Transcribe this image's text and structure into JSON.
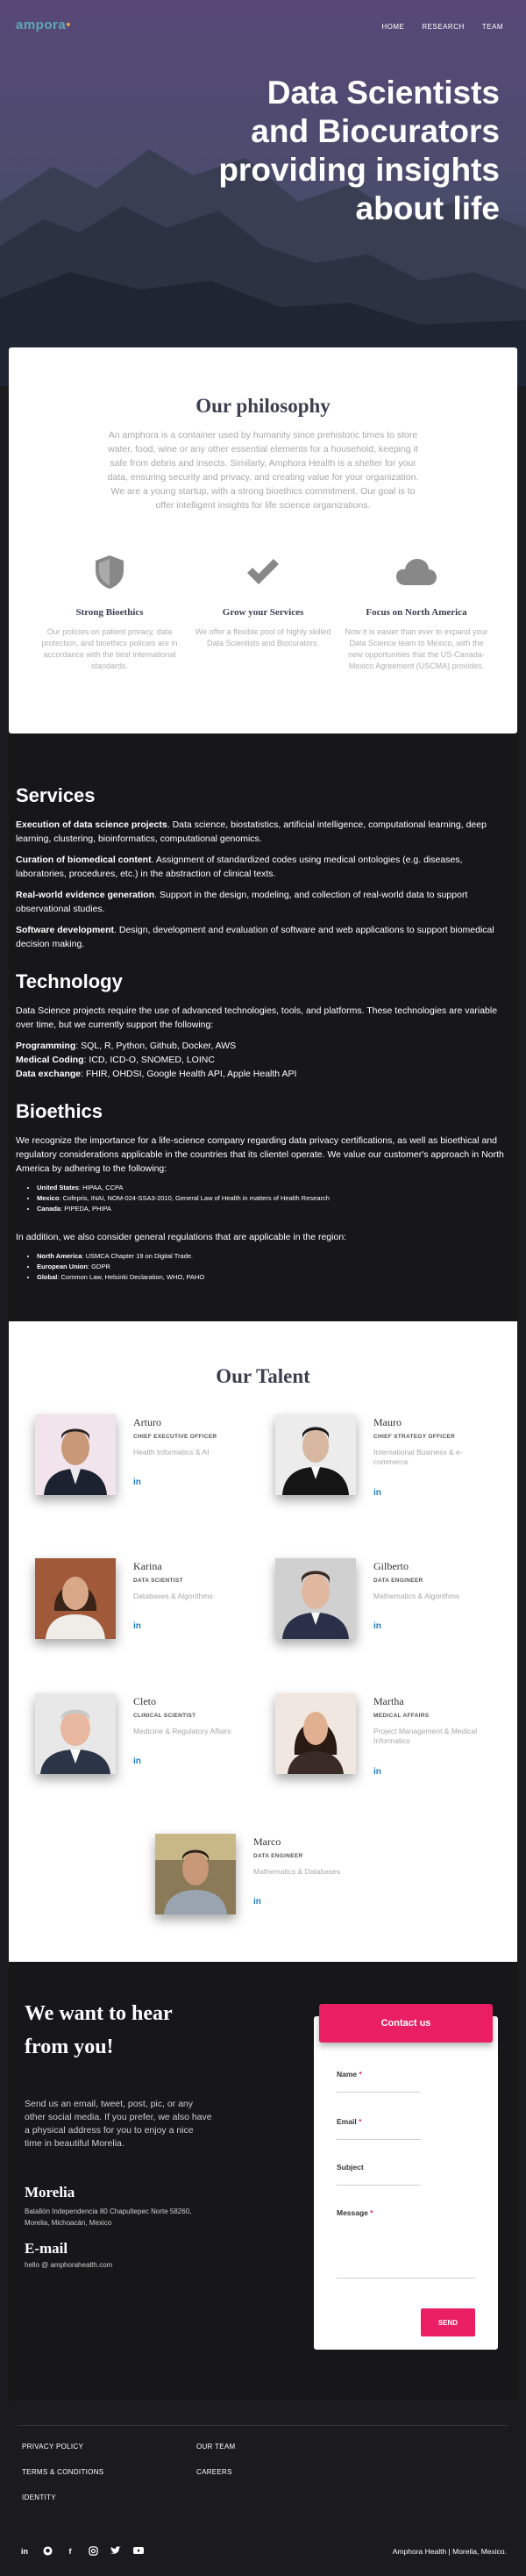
{
  "brand": {
    "logo_text": "ampora"
  },
  "nav": {
    "items": [
      "HOME",
      "RESEARCH",
      "TEAM"
    ]
  },
  "hero": {
    "title": "Data Scientists and Biocurators providing insights about life"
  },
  "philosophy": {
    "title": "Our philosophy",
    "text": "An amphora is a container used by humanity since prehistoric times to store water, food, wine or any other essential elements for a household, keeping it safe from debris and insects. Similarly, Amphora Health is a shelter for your data, ensuring security and privacy, and creating value for your organization. We are a young startup, with a strong bioethics commitment. Our goal is to offer intelligent insights for life science organizations.",
    "features": [
      {
        "icon": "shield-icon",
        "title": "Strong Bioethics",
        "text": "Our policies on patient privacy, data protection, and bioethics policies are in accordance with the best international standards."
      },
      {
        "icon": "check-icon",
        "title": "Grow your Services",
        "text": "We offer a flexible pool of highly skilled Data Scientists and Biocurators."
      },
      {
        "icon": "cloud-icon",
        "title": "Focus on North America",
        "text": "Now it is easier than ever to expand your Data Science team to Mexico, with the new opportunities that the US-Canada-Mexico Agreement (USCMA) provides."
      }
    ]
  },
  "services": {
    "title": "Services",
    "items": [
      {
        "label": "Execution of data science projects",
        "text": ". Data science, biostatistics, artificial intelligence, computational learning, deep learning, clustering, bioinformatics, computational genomics."
      },
      {
        "label": "Curation of biomedical content",
        "text": ". Assignment of standardized codes using medical ontologies (e.g. diseases, laboratories, procedures, etc.) in the abstraction of clinical texts."
      },
      {
        "label": "Real-world evidence generation",
        "text": ". Support in the design, modeling, and collection of real-world data to support observational studies."
      },
      {
        "label": "Software development",
        "text": ". Design, development and evaluation of software and web applications to support biomedical decision making."
      }
    ]
  },
  "technology": {
    "title": "Technology",
    "intro": "Data Science projects require the use of advanced technologies, tools, and platforms. These technologies are variable over time, but we currently support the following:",
    "items": [
      {
        "label": "Programming",
        "text": ": SQL, R, Python, Github, Docker, AWS"
      },
      {
        "label": "Medical Coding",
        "text": ": ICD, ICD-O, SNOMED, LOINC"
      },
      {
        "label": "Data exchange",
        "text": ": FHIR, OHDSI, Google Health API, Apple Health API"
      }
    ]
  },
  "bioethics": {
    "title": "Bioethics",
    "intro": "We recognize the importance for a life-science company regarding data privacy certifications, as well as bioethical and regulatory considerations applicable in the countries that its clientel operate. We value our customer's approach in North America by adhering to the following:",
    "countries": [
      {
        "label": "United States",
        "text": ": HIPAA, CCPA"
      },
      {
        "label": "Mexico",
        "text": ": Cofepris, INAI, NOM-024-SSA3-2010, General Law of Health in matters of Health Research"
      },
      {
        "label": "Canada",
        "text": ": PIPEDA, PHIPA"
      }
    ],
    "general_intro": "In addition, we also consider general regulations that are applicable in the region:",
    "general": [
      {
        "label": "North America",
        "text": ": USMCA Chapter 19 on Digital Trade."
      },
      {
        "label": "European Union",
        "text": ": GDPR"
      },
      {
        "label": "Global",
        "text": ": Common Law, Helsinki Declaration, WHO, PAHO"
      }
    ]
  },
  "talent": {
    "title": "Our Talent",
    "linkedin_label": "in",
    "people": [
      {
        "name": "Arturo",
        "role": "CHIEF EXECUTIVE OFFICER",
        "desc": "Health Informatics & AI"
      },
      {
        "name": "Mauro",
        "role": "CHIEF STRATEGY OFFICER",
        "desc": "International Business & e-commerce"
      },
      {
        "name": "Karina",
        "role": "DATA SCIENTIST",
        "desc": "Databases & Algorithms"
      },
      {
        "name": "Gilberto",
        "role": "DATA ENGINEER",
        "desc": "Mathematics & Algorithms"
      },
      {
        "name": "Cleto",
        "role": "CLINICAL SCIENTIST",
        "desc": "Medicine & Regulatory Affairs"
      },
      {
        "name": "Martha",
        "role": "MEDICAL AFFAIRS",
        "desc": "Project Management & Medical Informatics"
      },
      {
        "name": "Marco",
        "role": "DATA ENGINEER",
        "desc": "Mathematics & Databases"
      }
    ]
  },
  "contact": {
    "heading": "We want to hear from you!",
    "text": "Send us an email, tweet, post, pic, or any other social media. If you prefer, we also have a physical address for you to enjoy a nice time in beautiful Morelia.",
    "location_title": "Morelia",
    "address": "Batallón Independencia 80 Chapultepec Norte 58260, Morelia, Michoacán, Mexico",
    "email_title": "E-mail",
    "email": "hello @ amphorahealth.com",
    "form": {
      "title": "Contact us",
      "fields": [
        "Name",
        "Email",
        "Subject",
        "Message"
      ],
      "required_mark": "*",
      "send": "SEND"
    }
  },
  "footer": {
    "links_left": [
      "PRIVACY POLICY",
      "TERMS & CONDITIONS",
      "IDENTITY"
    ],
    "links_right": [
      "OUR TEAM",
      "CAREERS"
    ],
    "socials": [
      "linkedin-icon",
      "github-icon",
      "facebook-icon",
      "instagram-icon",
      "twitter-icon",
      "youtube-icon"
    ],
    "copyright": "Amphora Health | Morelia, Mexico."
  },
  "colors": {
    "accent": "#e91e63",
    "link": "#1e7bc4",
    "dark": "#171719"
  }
}
